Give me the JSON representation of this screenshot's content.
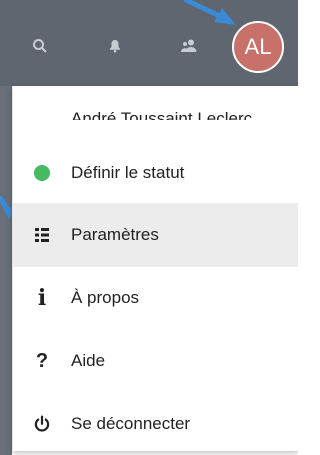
{
  "colors": {
    "header_bg": "#5f6670",
    "avatar_bg": "#c8706a",
    "status_online": "#46ba61",
    "active_row": "#ececec",
    "annotation_arrow": "#3a8ad6"
  },
  "header": {
    "icons": [
      "search-icon",
      "notifications-icon",
      "contacts-icon"
    ],
    "avatar": {
      "initials": "AL"
    }
  },
  "menu": {
    "user_name": "André Toussaint Leclerc",
    "items": [
      {
        "label": "Définir le statut",
        "icon": "status-dot-icon",
        "active": false
      },
      {
        "label": "Paramètres",
        "icon": "settings-list-icon",
        "active": true
      },
      {
        "label": "À propos",
        "icon": "info-icon",
        "active": false
      },
      {
        "label": "Aide",
        "icon": "help-icon",
        "active": false
      },
      {
        "label": "Se déconnecter",
        "icon": "power-icon",
        "active": false
      }
    ]
  }
}
